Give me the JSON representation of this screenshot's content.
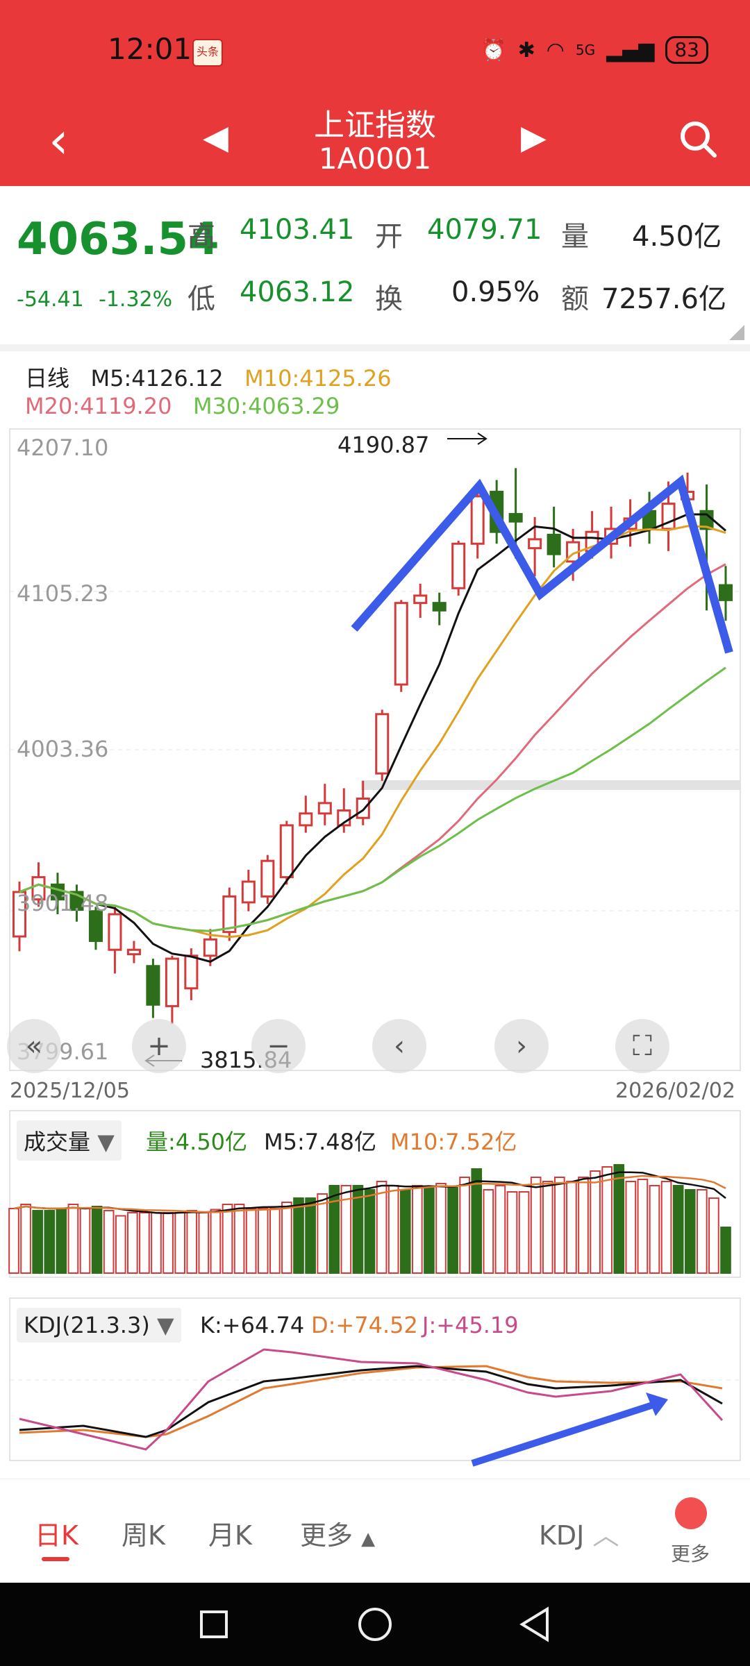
{
  "status": {
    "time": "12:01",
    "battery": "83",
    "signal": "5G",
    "app_icon": "头条"
  },
  "header": {
    "title": "上证指数",
    "code": "1A0001"
  },
  "quote": {
    "price": "4063.54",
    "change": "-54.41",
    "change_pct": "-1.32%",
    "high_label": "高",
    "high": "4103.41",
    "open_label": "开",
    "open": "4079.71",
    "volume_label": "量",
    "volume": "4.50亿",
    "low_label": "低",
    "low": "4063.12",
    "turnover_label": "换",
    "turnover": "0.95%",
    "amount_label": "额",
    "amount": "7257.6亿"
  },
  "kline": {
    "period": "日线",
    "m5": "M5:4126.12",
    "m10": "M10:4125.26",
    "m20": "M20:4119.20",
    "m30": "M30:4063.29",
    "y_ticks": [
      "4207.10",
      "4105.23",
      "4003.36",
      "3901.48",
      "3799.61"
    ],
    "max_label": "4190.87",
    "min_label": "3815.84",
    "start_date": "2025/12/05",
    "end_date": "2026/02/02",
    "colors": {
      "m5": "#111111",
      "m10": "#e0a020",
      "m20": "#e06a7a",
      "m30": "#6cc04a",
      "up": "#d43a3a",
      "down": "#2d6e1a",
      "annotation": "#3b5be8"
    }
  },
  "volume_panel": {
    "name": "成交量",
    "vol": "量:4.50亿",
    "m5": "M5:7.48亿",
    "m10": "M10:7.52亿"
  },
  "kdj_panel": {
    "name": "KDJ(21.3.3)",
    "k": "K:+64.74",
    "d": "D:+74.52",
    "j": "J:+45.19"
  },
  "tabs": {
    "day": "日K",
    "week": "周K",
    "month": "月K",
    "more": "更多",
    "indicator": "KDJ",
    "more2": "更多"
  },
  "chart_data": {
    "type": "candlestick",
    "ylim": [
      3799.61,
      4207.1
    ],
    "candles": [
      {
        "o": 3875,
        "c": 3905,
        "h": 3912,
        "l": 3865
      },
      {
        "o": 3900,
        "c": 3915,
        "h": 3925,
        "l": 3895
      },
      {
        "o": 3910,
        "c": 3900,
        "h": 3918,
        "l": 3890
      },
      {
        "o": 3905,
        "c": 3893,
        "h": 3910,
        "l": 3885
      },
      {
        "o": 3892,
        "c": 3872,
        "h": 3895,
        "l": 3866
      },
      {
        "o": 3866,
        "c": 3890,
        "h": 3895,
        "l": 3850
      },
      {
        "o": 3863,
        "c": 3866,
        "h": 3872,
        "l": 3857
      },
      {
        "o": 3855,
        "c": 3829,
        "h": 3860,
        "l": 3820
      },
      {
        "o": 3828,
        "c": 3860,
        "h": 3862,
        "l": 3816
      },
      {
        "o": 3840,
        "c": 3862,
        "h": 3867,
        "l": 3832
      },
      {
        "o": 3862,
        "c": 3873,
        "h": 3880,
        "l": 3855
      },
      {
        "o": 3878,
        "c": 3902,
        "h": 3908,
        "l": 3872
      },
      {
        "o": 3898,
        "c": 3912,
        "h": 3920,
        "l": 3892
      },
      {
        "o": 3902,
        "c": 3926,
        "h": 3930,
        "l": 3897
      },
      {
        "o": 3915,
        "c": 3950,
        "h": 3953,
        "l": 3910
      },
      {
        "o": 3950,
        "c": 3958,
        "h": 3970,
        "l": 3945
      },
      {
        "o": 3958,
        "c": 3965,
        "h": 3978,
        "l": 3950
      },
      {
        "o": 3950,
        "c": 3960,
        "h": 3975,
        "l": 3945
      },
      {
        "o": 3955,
        "c": 3968,
        "h": 3980,
        "l": 3950
      },
      {
        "o": 3985,
        "c": 4025,
        "h": 4028,
        "l": 3980
      },
      {
        "o": 4045,
        "c": 4100,
        "h": 4102,
        "l": 4040
      },
      {
        "o": 4100,
        "c": 4105,
        "h": 4113,
        "l": 4090
      },
      {
        "o": 4100,
        "c": 4095,
        "h": 4107,
        "l": 4085
      },
      {
        "o": 4110,
        "c": 4140,
        "h": 4142,
        "l": 4105
      },
      {
        "o": 4140,
        "c": 4172,
        "h": 4178,
        "l": 4130
      },
      {
        "o": 4175,
        "c": 4148,
        "h": 4183,
        "l": 4140
      },
      {
        "o": 4160,
        "c": 4155,
        "h": 4191,
        "l": 4130
      },
      {
        "o": 4137,
        "c": 4143,
        "h": 4158,
        "l": 4118
      },
      {
        "o": 4146,
        "c": 4133,
        "h": 4165,
        "l": 4124
      },
      {
        "o": 4128,
        "c": 4141,
        "h": 4150,
        "l": 4115
      },
      {
        "o": 4135,
        "c": 4148,
        "h": 4162,
        "l": 4130
      },
      {
        "o": 4140,
        "c": 4150,
        "h": 4165,
        "l": 4130
      },
      {
        "o": 4150,
        "c": 4157,
        "h": 4170,
        "l": 4138
      },
      {
        "o": 4162,
        "c": 4150,
        "h": 4175,
        "l": 4140
      },
      {
        "o": 4150,
        "c": 4167,
        "h": 4182,
        "l": 4135
      },
      {
        "o": 4170,
        "c": 4175,
        "h": 4188,
        "l": 4160
      },
      {
        "o": 4162,
        "c": 4150,
        "h": 4180,
        "l": 4095
      },
      {
        "o": 4112,
        "c": 4102,
        "h": 4125,
        "l": 4088
      }
    ],
    "volume": [
      0.62,
      0.66,
      0.6,
      0.6,
      0.62,
      0.66,
      0.62,
      0.64,
      0.6,
      0.55,
      0.58,
      0.58,
      0.58,
      0.58,
      0.58,
      0.6,
      0.58,
      0.61,
      0.66,
      0.66,
      0.62,
      0.62,
      0.62,
      0.68,
      0.72,
      0.72,
      0.76,
      0.84,
      0.84,
      0.84,
      0.8,
      0.88,
      0.84,
      0.8,
      0.84,
      0.82,
      0.86,
      0.82,
      0.92,
      1.0,
      0.8,
      0.84,
      0.78,
      0.78,
      0.92,
      0.88,
      0.92,
      0.88,
      0.92,
      0.98,
      1.02,
      1.04,
      0.88,
      0.9,
      0.84,
      0.88,
      0.84,
      0.8,
      0.8,
      0.72,
      0.44
    ]
  }
}
